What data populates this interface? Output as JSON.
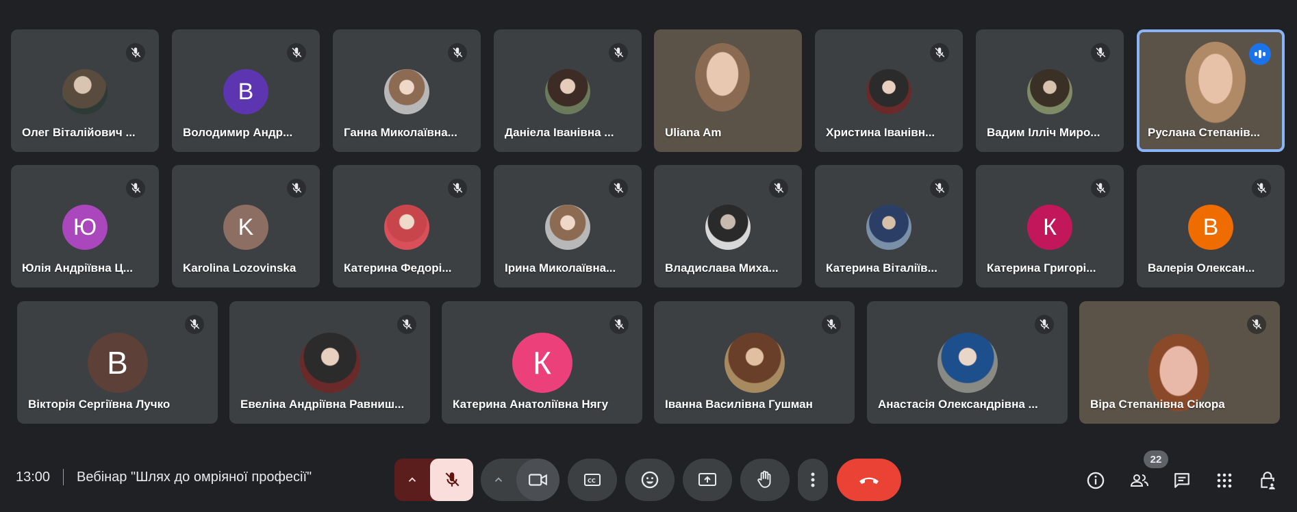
{
  "colors": {
    "background": "#202124",
    "tile": "#3c4043",
    "active_border": "#8ab4f8",
    "end_call": "#ea4335",
    "mic_muted_bg": "#f9dedc"
  },
  "participants": [
    {
      "name": "Олег Віталійович ...",
      "avatar_type": "photo"
    },
    {
      "name": "Володимир Андр...",
      "avatar_letter": "В",
      "avatar_color": "#5e35b1"
    },
    {
      "name": "Ганна Миколаївна...",
      "avatar_type": "photo"
    },
    {
      "name": "Даніела Іванівна ...",
      "avatar_type": "photo"
    },
    {
      "name": "Uliana Am",
      "avatar_type": "video"
    },
    {
      "name": "Христина Іванівн...",
      "avatar_type": "photo"
    },
    {
      "name": "Вадим Ілліч Миро...",
      "avatar_type": "photo"
    },
    {
      "name": "Руслана Степанів...",
      "avatar_type": "video",
      "speaking": true
    },
    {
      "name": "Юлія Андріївна Ц...",
      "avatar_letter": "Ю",
      "avatar_color": "#ab47bc"
    },
    {
      "name": "Karolina Lozovinska",
      "avatar_letter": "K",
      "avatar_color": "#8d6e63"
    },
    {
      "name": "Катерина Федорі...",
      "avatar_type": "photo"
    },
    {
      "name": "Ірина Миколаївна...",
      "avatar_type": "photo"
    },
    {
      "name": "Владислава Миха...",
      "avatar_type": "photo"
    },
    {
      "name": "Катерина Віталіїв...",
      "avatar_type": "photo"
    },
    {
      "name": "Катерина Григорі...",
      "avatar_letter": "К",
      "avatar_color": "#c2185b"
    },
    {
      "name": "Валерія Олексан...",
      "avatar_letter": "В",
      "avatar_color": "#ef6c00"
    },
    {
      "name": "Вікторія Сергіївна Лучко",
      "avatar_letter": "В",
      "avatar_color": "#5d4037"
    },
    {
      "name": "Евеліна Андріївна Равниш...",
      "avatar_type": "photo"
    },
    {
      "name": "Катерина Анатоліївна Нягу",
      "avatar_letter": "К",
      "avatar_color": "#ec407a"
    },
    {
      "name": "Іванна Василівна Гушман",
      "avatar_type": "photo"
    },
    {
      "name": "Анастасія Олександрівна ...",
      "avatar_type": "photo"
    },
    {
      "name": "Віра Степанівна Сікора",
      "avatar_type": "video"
    }
  ],
  "bottom_bar": {
    "time": "13:00",
    "meeting_title": "Вебінар \"Шлях до омріяної професії\"",
    "participant_count": "22",
    "icons": {
      "mic_chevron": "chevron-up-icon",
      "mic": "mic-off-icon",
      "cam_chevron": "chevron-up-icon",
      "camera": "videocam-icon",
      "captions": "closed-captions-icon",
      "emoji": "emoji-icon",
      "present": "present-screen-icon",
      "raise_hand": "raise-hand-icon",
      "more": "more-vert-icon",
      "end_call": "call-end-icon",
      "info": "info-icon",
      "people": "people-icon",
      "chat": "chat-icon",
      "activities": "apps-grid-icon",
      "host_controls": "lock-person-icon"
    }
  }
}
